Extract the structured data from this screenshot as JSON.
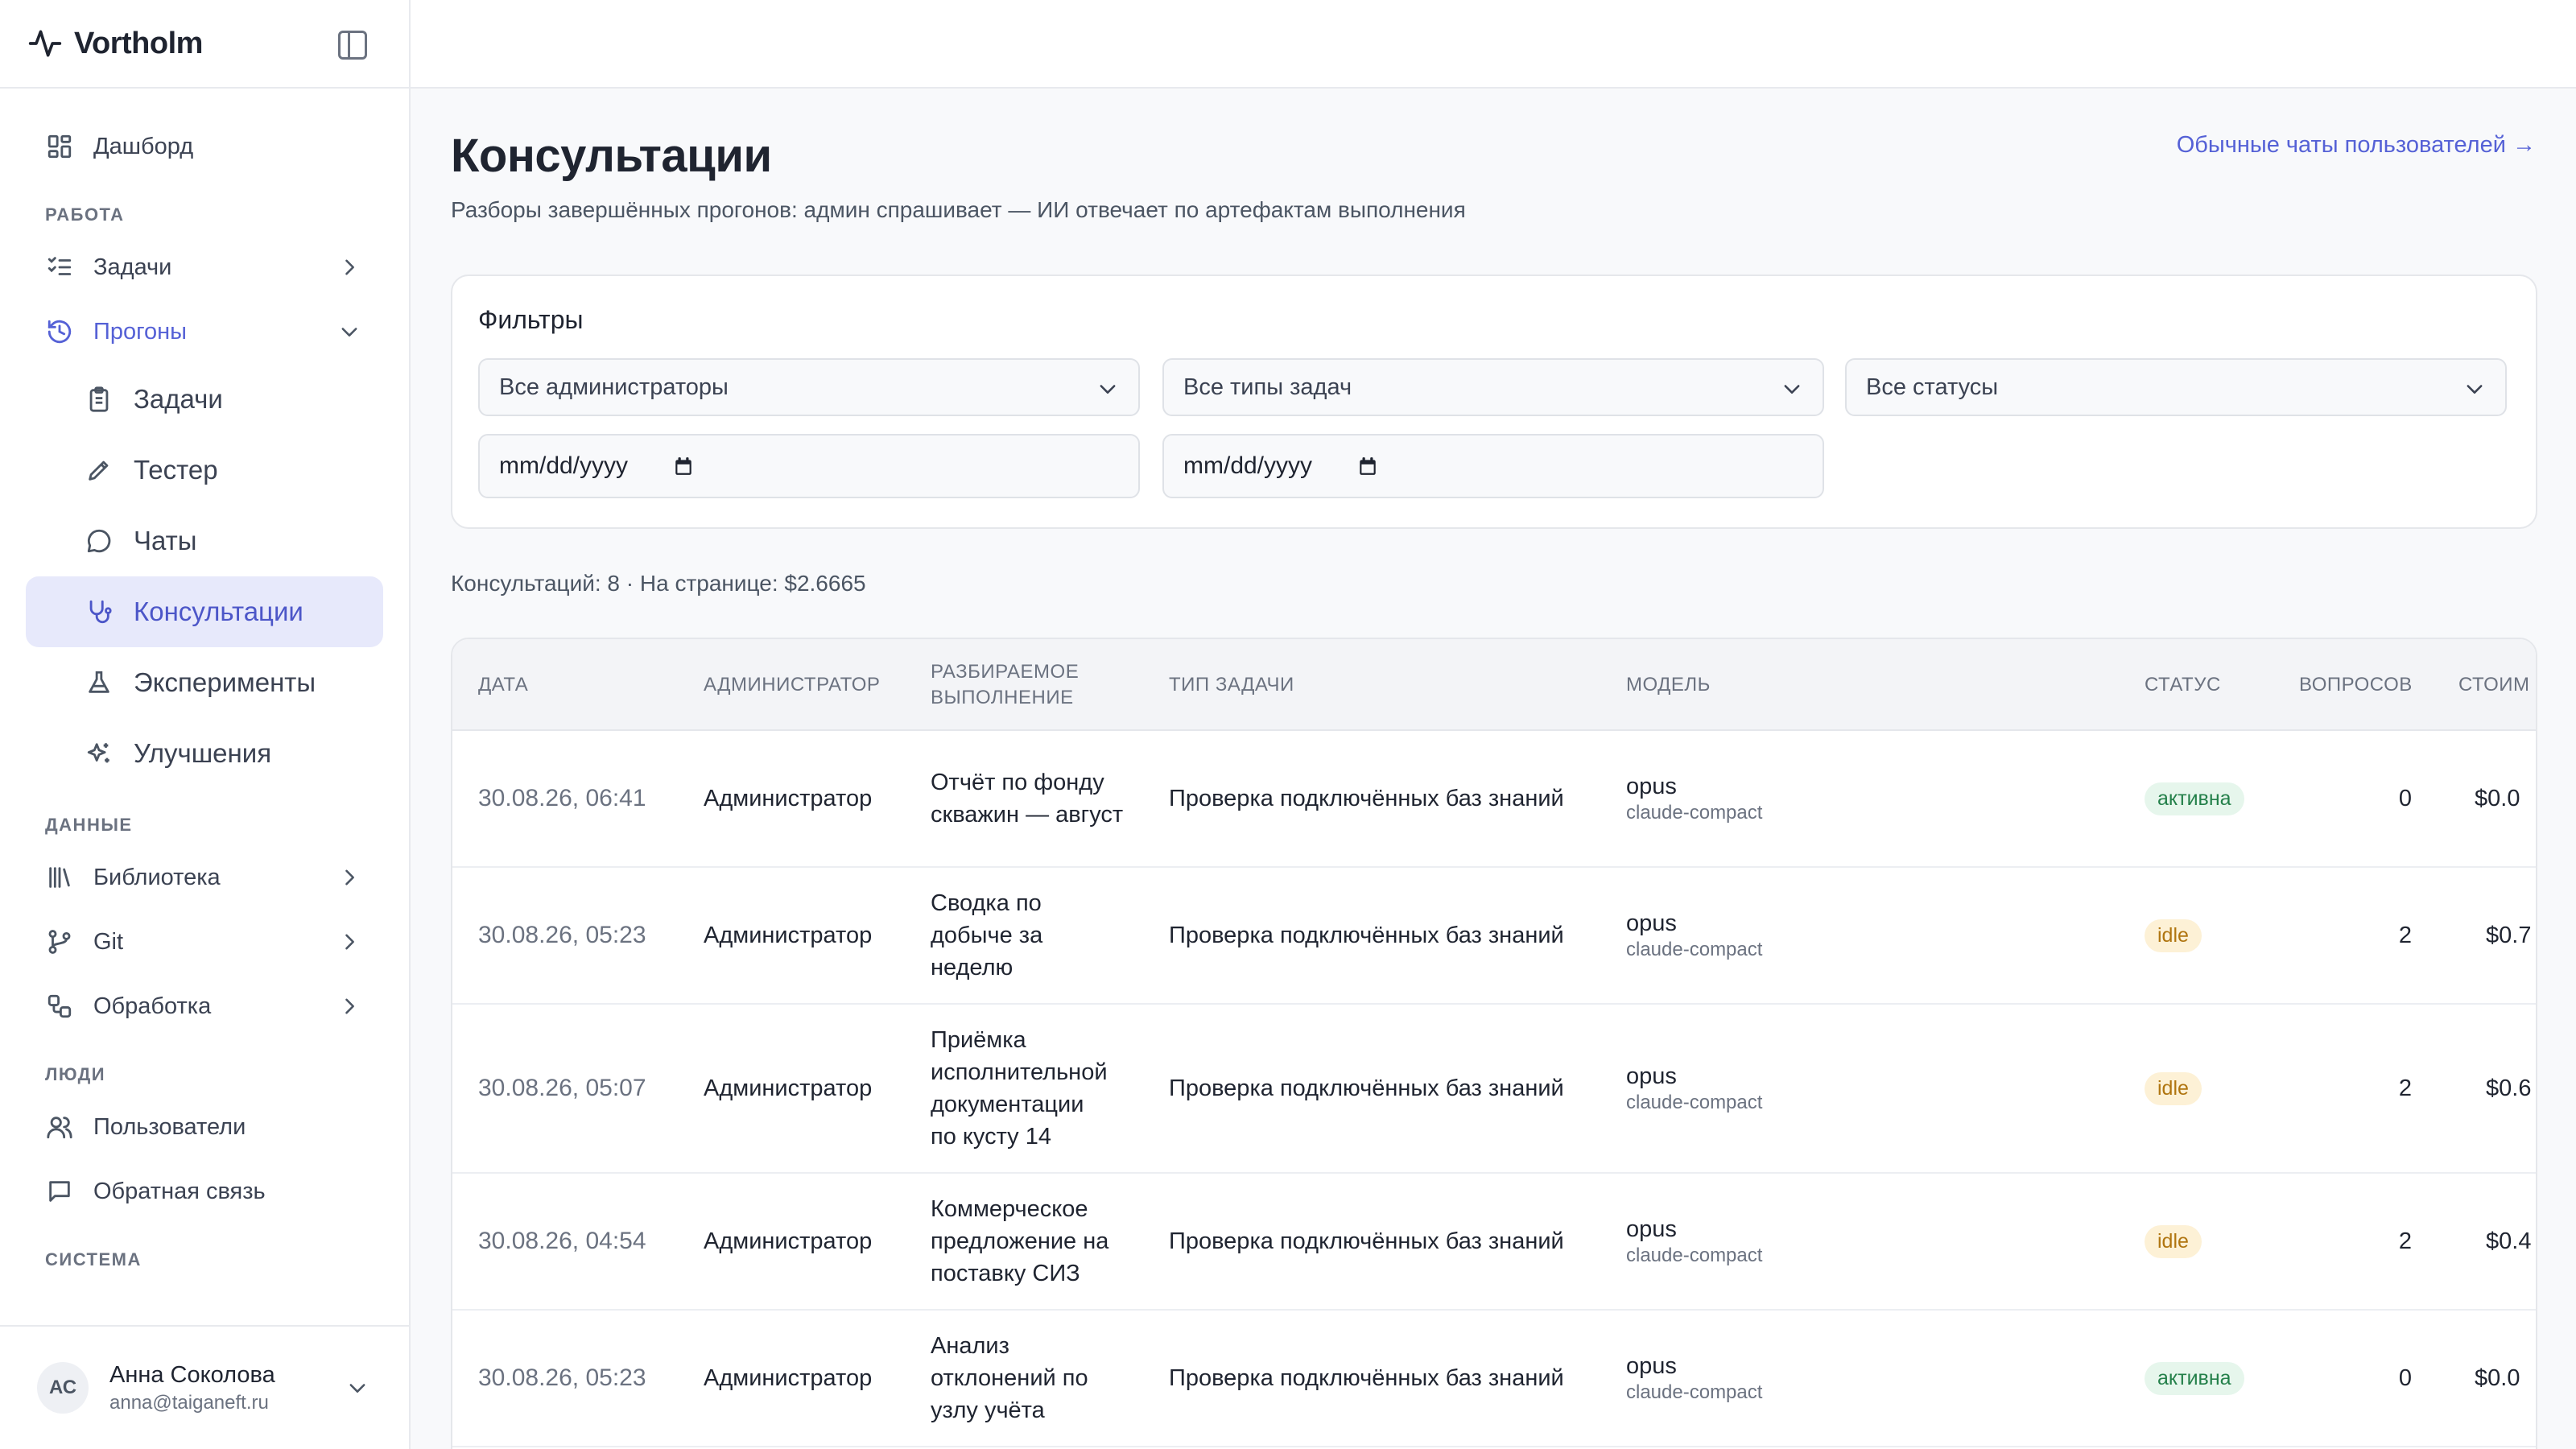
{
  "app": {
    "name": "Vortholm"
  },
  "sidebar": {
    "dashboard": "Дашборд",
    "section_work": "РАБОТА",
    "tasks": "Задачи",
    "runs": "Прогоны",
    "runs_sub": [
      {
        "label": "Задачи",
        "icon": "clipboard-icon"
      },
      {
        "label": "Тестер",
        "icon": "pencil-icon"
      },
      {
        "label": "Чаты",
        "icon": "chat-bubble-icon"
      },
      {
        "label": "Консультации",
        "icon": "stethoscope-icon"
      },
      {
        "label": "Эксперименты",
        "icon": "flask-icon"
      },
      {
        "label": "Улучшения",
        "icon": "sparkles-icon"
      }
    ],
    "section_data": "ДАННЫЕ",
    "library": "Библиотека",
    "git": "Git",
    "processing": "Обработка",
    "section_people": "ЛЮДИ",
    "users": "Пользователи",
    "feedback": "Обратная связь",
    "section_system": "СИСТЕМА",
    "user": {
      "initials": "АС",
      "name": "Анна Соколова",
      "email": "anna@taiganeft.ru"
    }
  },
  "main": {
    "title": "Консультации",
    "subtitle": "Разборы завершённых прогонов: админ спрашивает — ИИ отвечает по артефактам выполнения",
    "top_link": "Обычные чаты пользователей →",
    "filters": {
      "title": "Фильтры",
      "admins": "Все администраторы",
      "task_types": "Все типы задач",
      "statuses": "Все статусы",
      "date_from": "mm/dd/yyyy",
      "date_to": "mm/dd/yyyy"
    },
    "summary": "Консультаций: 8 · На странице: $2.6665",
    "table": {
      "headers": {
        "date": "ДАТА",
        "admin": "АДМИНИСТРАТОР",
        "run": "РАЗБИРАЕМОЕ ВЫПОЛНЕНИЕ",
        "task_type": "ТИП ЗАДАЧИ",
        "model": "МОДЕЛЬ",
        "status": "СТАТУС",
        "questions": "ВОПРОСОВ",
        "cost": "СТОИМ"
      },
      "rows": [
        {
          "date": "30.08.26, 06:41",
          "admin": "Администратор",
          "run": "Отчёт по фонду скважин — август",
          "task_type": "Проверка подключённых баз знаний",
          "model": "opus",
          "model_sub": "claude-compact",
          "status": "активна",
          "status_kind": "active",
          "questions": "0",
          "cost": "$0.0"
        },
        {
          "date": "30.08.26, 05:23",
          "admin": "Администратор",
          "run": "Сводка по добыче за неделю",
          "task_type": "Проверка подключённых баз знаний",
          "model": "opus",
          "model_sub": "claude-compact",
          "status": "idle",
          "status_kind": "idle",
          "questions": "2",
          "cost": "$0.7"
        },
        {
          "date": "30.08.26, 05:07",
          "admin": "Администратор",
          "run": "Приёмка исполнительной документации по кусту 14",
          "task_type": "Проверка подключённых баз знаний",
          "model": "opus",
          "model_sub": "claude-compact",
          "status": "idle",
          "status_kind": "idle",
          "questions": "2",
          "cost": "$0.6"
        },
        {
          "date": "30.08.26, 04:54",
          "admin": "Администратор",
          "run": "Коммерческое предложение на поставку СИЗ",
          "task_type": "Проверка подключённых баз знаний",
          "model": "opus",
          "model_sub": "claude-compact",
          "status": "idle",
          "status_kind": "idle",
          "questions": "2",
          "cost": "$0.4"
        },
        {
          "date": "30.08.26, 05:23",
          "admin": "Администратор",
          "run": "Анализ отклонений по узлу учёта",
          "task_type": "Проверка подключённых баз знаний",
          "model": "opus",
          "model_sub": "claude-compact",
          "status": "активна",
          "status_kind": "active",
          "questions": "0",
          "cost": "$0.0"
        }
      ]
    }
  }
}
